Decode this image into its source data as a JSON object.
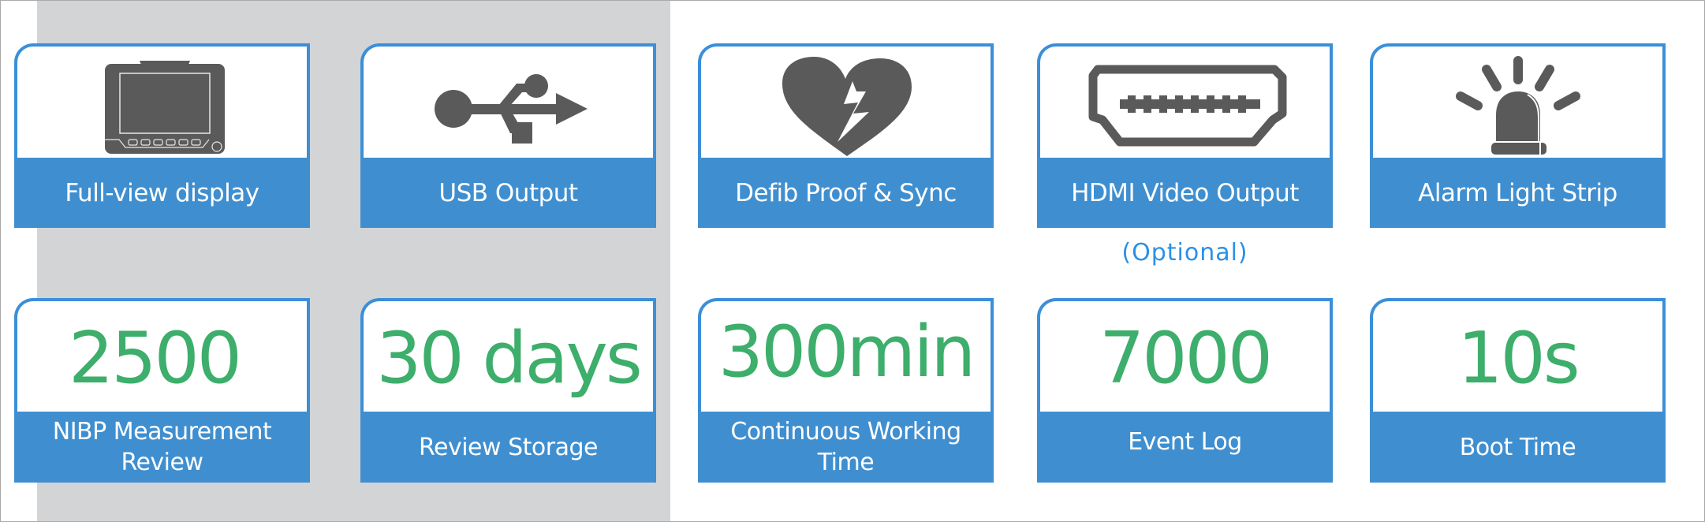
{
  "features": [
    {
      "label": "Full-view display",
      "icon": "monitor-icon"
    },
    {
      "label": "USB Output",
      "icon": "usb-icon"
    },
    {
      "label": "Defib Proof & Sync",
      "icon": "defib-heart-icon"
    },
    {
      "label": "HDMI Video Output",
      "icon": "hdmi-port-icon",
      "note": "(Optional)"
    },
    {
      "label": "Alarm Light Strip",
      "icon": "alarm-light-icon"
    }
  ],
  "specs": [
    {
      "value": "2500",
      "label_lines": [
        "NIBP Measurement",
        "Review"
      ]
    },
    {
      "value": "30 days",
      "label_lines": [
        "Review Storage"
      ]
    },
    {
      "value": "300min",
      "label_lines": [
        "Continuous Working",
        "Time"
      ]
    },
    {
      "value": "7000",
      "label_lines": [
        "Event Log"
      ]
    },
    {
      "value": "10s",
      "label_lines": [
        "Boot Time"
      ]
    }
  ],
  "colors": {
    "card_border": "#3b8fd9",
    "label_band": "#3f8fd0",
    "value_green": "#3dae6b",
    "icon_gray": "#5a5a5a",
    "optional_blue": "#2b90e6",
    "panel_gray": "#d3d4d6"
  }
}
